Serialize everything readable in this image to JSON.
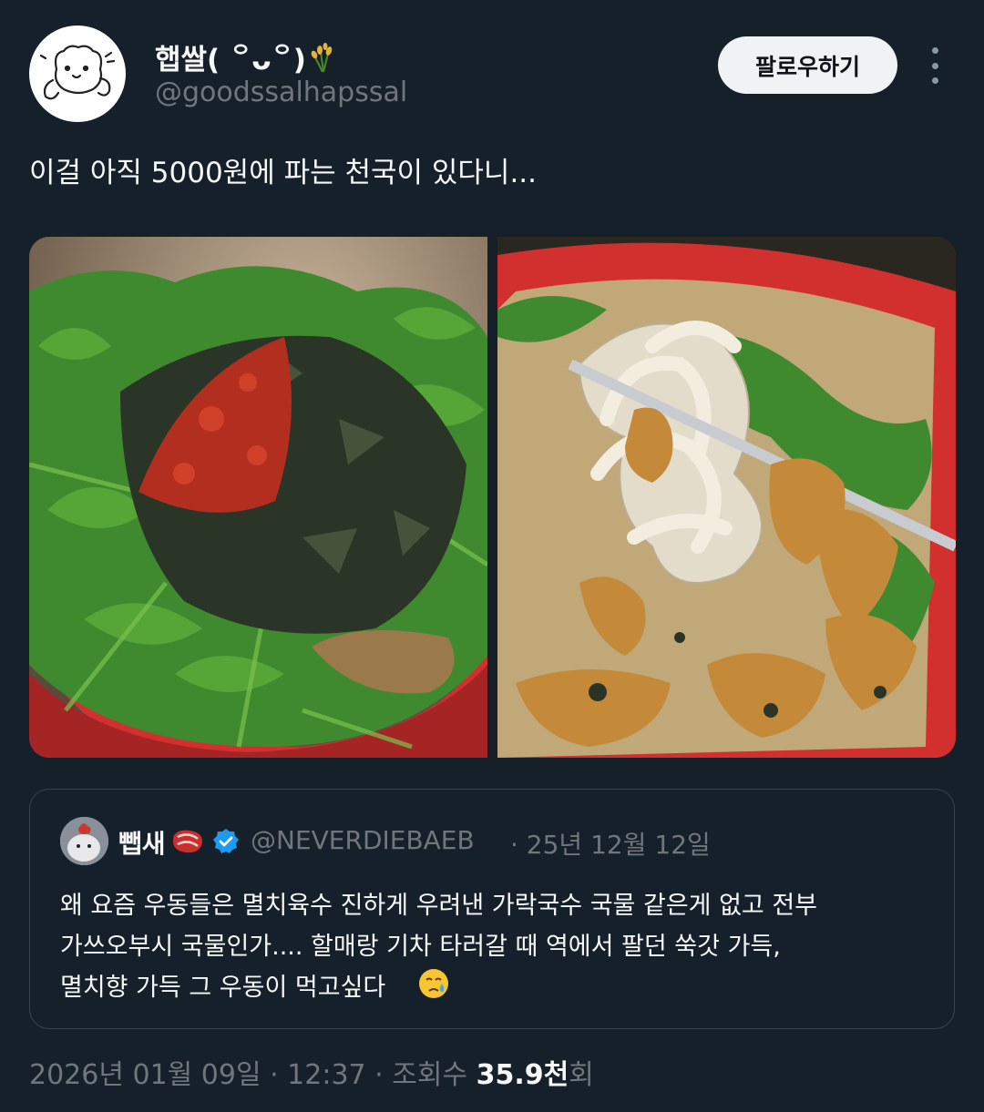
{
  "author": {
    "display_name": "햅쌀( ꒪ᴗ꒪)",
    "name_emoji": "rice-sheaf-icon",
    "handle": "@goodssalhapssal",
    "avatar": "cartoon-bear-avatar"
  },
  "follow_label": "팔로우하기",
  "more_icon": "more-vertical-icon",
  "tweet_text": "이걸 아직 5000원에 파는 천국이 있다니...",
  "media": [
    {
      "alt": "bowl-of-udon-with-crown-daisy-seaweed-and-chili-flakes"
    },
    {
      "alt": "udon-noodles-lifted-with-chopsticks-over-fried-tofu"
    }
  ],
  "quote": {
    "display_name": "뺍새",
    "name_emoji": "steak-icon",
    "verified_icon": "verified-badge-icon",
    "handle": "@NEVERDIEBAEB",
    "date": "· 25년 12월 12일",
    "lines": [
      "왜 요즘 우동들은 멸치육수 진하게 우려낸 가락국수 국물 같은게 없고 전부",
      "가쓰오부시 국물인가.... 할매랑 기차 타러갈 때 역에서 팔던 쑥갓 가득,",
      "멸치향 가득 그 우동이 먹고싶다"
    ],
    "trailing_emoji": "crying-face-icon"
  },
  "meta": {
    "datetime": "2026년 01월 09일 · 12:37 · 조회수 ",
    "views": "35.9천",
    "views_suffix": "회"
  },
  "colors": {
    "background": "#16202a",
    "text": "#f7f9f9",
    "secondary": "#71767b",
    "border": "#38444d",
    "verified": "#1d9bf0",
    "follow_bg": "#eff3f4"
  }
}
